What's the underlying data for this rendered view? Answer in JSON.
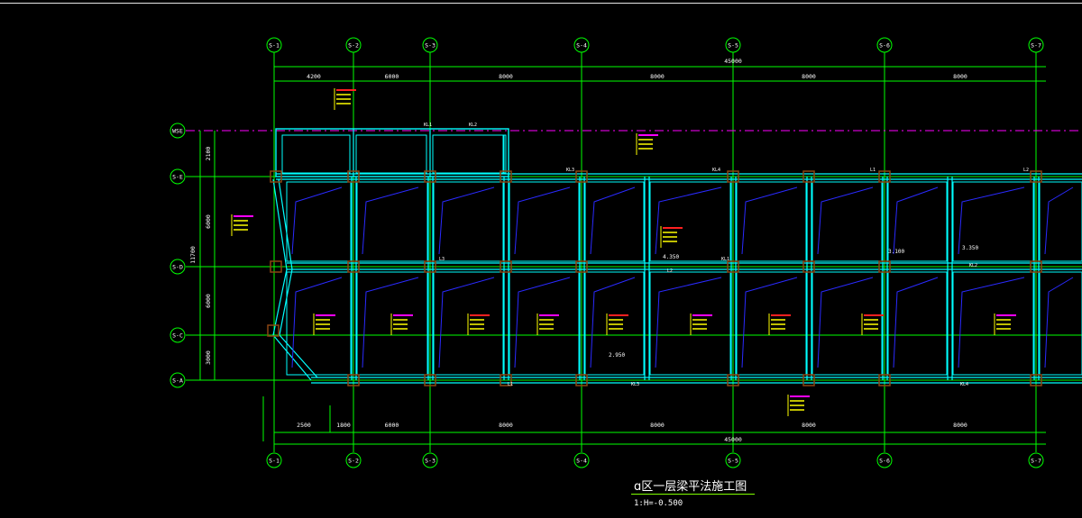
{
  "drawing": {
    "title": "ɑ区一层梁平法施工图",
    "scale": "1:H=-0.500",
    "colors": {
      "background": "#000000",
      "axis": "#00ff00",
      "beam": "#00ffff",
      "slab": "#2a2aff",
      "label_text": "#ffffff",
      "note_yellow": "#ffff00",
      "note_magenta": "#ff00ff",
      "note_red": "#ff2020",
      "column": "#8b4513"
    }
  },
  "axes": {
    "columns": [
      "S-1",
      "S-2",
      "S-3",
      "S-4",
      "S-5",
      "S-6",
      "S-7"
    ],
    "rows": [
      "WSE",
      "S-E",
      "S-D",
      "S-C",
      "S-A"
    ]
  },
  "dimensions": {
    "top_segments": [
      "4200",
      "6000",
      "8000",
      "8000",
      "8000",
      "8000"
    ],
    "top_total": "45000",
    "bottom_segments": [
      "2500",
      "1800",
      "6000",
      "8000",
      "8000",
      "8000",
      "8000"
    ],
    "bottom_total": "45000",
    "left_segments": [
      "2100",
      "6000",
      "6000",
      "3000"
    ],
    "left_total": "11700"
  },
  "annotations": {
    "beam_tags": [
      "KL1",
      "KL2",
      "KL3",
      "KL4",
      "L1",
      "L2",
      "L3"
    ],
    "elev_notes": [
      "4.350",
      "3.350",
      "3.100",
      "2.950"
    ]
  }
}
